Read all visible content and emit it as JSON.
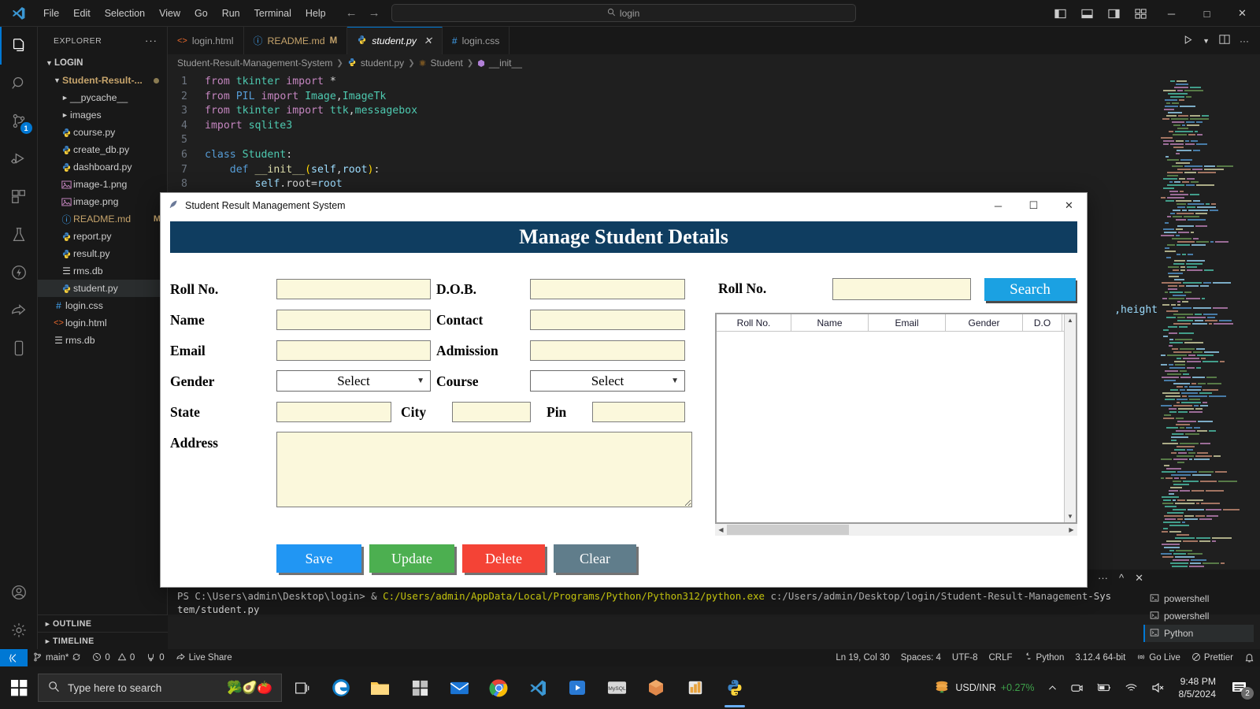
{
  "vscode": {
    "menus": [
      "File",
      "Edit",
      "Selection",
      "View",
      "Go",
      "Run",
      "Terminal",
      "Help"
    ],
    "command_center": {
      "text": "login",
      "icon": "search-icon"
    },
    "window_controls": {
      "minimize": "─",
      "maximize": "□",
      "close": "✕"
    },
    "activity_bar": {
      "source_control_badge": "1"
    },
    "sidebar": {
      "title": "EXPLORER",
      "more_actions": "···",
      "root": "LOGIN",
      "items": [
        {
          "label": "Student-Result-...",
          "type": "folder",
          "expanded": true,
          "indent": 1,
          "dirty": true
        },
        {
          "label": "__pycache__",
          "type": "folder",
          "expanded": false,
          "indent": 2
        },
        {
          "label": "images",
          "type": "folder",
          "expanded": false,
          "indent": 2
        },
        {
          "label": "course.py",
          "type": "python",
          "indent": 2
        },
        {
          "label": "create_db.py",
          "type": "python",
          "indent": 2
        },
        {
          "label": "dashboard.py",
          "type": "python",
          "indent": 2
        },
        {
          "label": "image-1.png",
          "type": "image",
          "indent": 2
        },
        {
          "label": "image.png",
          "type": "image",
          "indent": 2
        },
        {
          "label": "README.md",
          "type": "markdown",
          "indent": 2,
          "badge": "M",
          "modified": true
        },
        {
          "label": "report.py",
          "type": "python",
          "indent": 2
        },
        {
          "label": "result.py",
          "type": "python",
          "indent": 2
        },
        {
          "label": "rms.db",
          "type": "database",
          "indent": 2
        },
        {
          "label": "student.py",
          "type": "python",
          "indent": 2,
          "selected": true
        },
        {
          "label": "login.css",
          "type": "css",
          "indent": 1
        },
        {
          "label": "login.html",
          "type": "html",
          "indent": 1
        },
        {
          "label": "rms.db",
          "type": "database",
          "indent": 1
        }
      ],
      "sections": [
        "OUTLINE",
        "TIMELINE"
      ]
    },
    "tabs": [
      {
        "label": "login.html",
        "icon": "html-icon",
        "active": false
      },
      {
        "label": "README.md",
        "icon": "markdown-icon",
        "active": false,
        "badge": "M"
      },
      {
        "label": "student.py",
        "icon": "python-icon",
        "active": true,
        "closeable": true
      },
      {
        "label": "login.css",
        "icon": "css-icon",
        "active": false
      }
    ],
    "breadcrumb": [
      "Student-Result-Management-System",
      "student.py",
      "Student",
      "__init__"
    ],
    "code_lines": [
      {
        "n": "1",
        "tokens": [
          [
            "k-kw",
            "from"
          ],
          [
            "k-txt",
            " "
          ],
          [
            "k-mod",
            "tkinter"
          ],
          [
            "k-txt",
            " "
          ],
          [
            "k-kw",
            "import"
          ],
          [
            "k-txt",
            " "
          ],
          [
            "k-star",
            "*"
          ]
        ]
      },
      {
        "n": "2",
        "tokens": [
          [
            "k-kw",
            "from"
          ],
          [
            "k-txt",
            " "
          ],
          [
            "k-cls",
            "PIL"
          ],
          [
            "k-txt",
            " "
          ],
          [
            "k-kw",
            "import"
          ],
          [
            "k-txt",
            " "
          ],
          [
            "k-mod",
            "Image"
          ],
          [
            "k-txt",
            ","
          ],
          [
            "k-mod",
            "ImageTk"
          ]
        ]
      },
      {
        "n": "3",
        "tokens": [
          [
            "k-kw",
            "from"
          ],
          [
            "k-txt",
            " "
          ],
          [
            "k-mod",
            "tkinter"
          ],
          [
            "k-txt",
            " "
          ],
          [
            "k-kw",
            "import"
          ],
          [
            "k-txt",
            " "
          ],
          [
            "k-mod",
            "ttk"
          ],
          [
            "k-txt",
            ","
          ],
          [
            "k-mod",
            "messagebox"
          ]
        ]
      },
      {
        "n": "4",
        "tokens": [
          [
            "k-kw",
            "import"
          ],
          [
            "k-txt",
            " "
          ],
          [
            "k-mod",
            "sqlite3"
          ]
        ]
      },
      {
        "n": "5",
        "tokens": []
      },
      {
        "n": "6",
        "tokens": [
          [
            "k-cls",
            "class"
          ],
          [
            "k-txt",
            " "
          ],
          [
            "k-name",
            "Student"
          ],
          [
            "k-txt",
            ":"
          ]
        ]
      },
      {
        "n": "7",
        "tokens": [
          [
            "k-txt",
            "    "
          ],
          [
            "k-cls",
            "def"
          ],
          [
            "k-txt",
            " "
          ],
          [
            "k-fn",
            "__init__"
          ],
          [
            "k-pl",
            "("
          ],
          [
            "k-par",
            "self"
          ],
          [
            "k-txt",
            ","
          ],
          [
            "k-par",
            "root"
          ],
          [
            "k-pl",
            ")"
          ],
          [
            "k-txt",
            ":"
          ]
        ]
      },
      {
        "n": "8",
        "tokens": [
          [
            "k-txt",
            "        "
          ],
          [
            "k-par",
            "self"
          ],
          [
            "k-txt",
            ".root="
          ],
          [
            "k-par",
            "root"
          ]
        ]
      }
    ],
    "code_right_snippet": ",height",
    "panel": {
      "terminal_text_line1_prompt": "PS C:\\Users\\admin\\Desktop\\login>",
      "terminal_text_line1_cmd": " & ",
      "terminal_text_line1_path": "C:/Users/admin/AppData/Local/Programs/Python/Python312/python.exe",
      "terminal_text_line1_arg": " c:/Users/admin/Desktop/login/Student-Result-Management-Sys",
      "terminal_text_line2": "tem/student.py",
      "actions": [
        "+",
        "⌄",
        "···",
        "∧",
        "✕"
      ],
      "terminals": [
        {
          "label": "powershell",
          "active": false
        },
        {
          "label": "powershell",
          "active": false
        },
        {
          "label": "Python",
          "active": true
        }
      ]
    },
    "statusbar": {
      "remote_icon": "remote-window-icon",
      "branch": "main*",
      "sync_icon": "sync-icon",
      "errors": "0",
      "warnings": "0",
      "ports": "0",
      "live_share": "Live Share",
      "cursor": "Ln 19, Col 30",
      "spaces": "Spaces: 4",
      "encoding": "UTF-8",
      "eol": "CRLF",
      "language": "Python",
      "interpreter": "3.12.4 64-bit",
      "go_live": "Go Live",
      "prettier": "Prettier",
      "bell": "notifications-icon"
    }
  },
  "taskbar": {
    "search_placeholder": "Type here to search",
    "emoji": "🥦🥑🍅",
    "apps": [
      "task-view-icon",
      "edge-icon",
      "file-explorer-icon",
      "store-icon",
      "mail-icon",
      "chrome-icon",
      "vscode-icon",
      "media-player-icon",
      "mysql-icon",
      "package-icon",
      "excel-icon",
      "python-app-icon"
    ],
    "tray": {
      "stock_label": "USD/INR",
      "stock_change": "+0.27%",
      "time": "9:48 PM",
      "date": "8/5/2024",
      "notification_count": "2"
    }
  },
  "dialog": {
    "window_title": "Student Result Management System",
    "header": "Manage Student Details",
    "controls": {
      "minimize": "─",
      "maximize": "☐",
      "close": "✕"
    },
    "fields": {
      "roll_no": {
        "label": "Roll No.",
        "value": ""
      },
      "dob": {
        "label": "D.O.B.",
        "value": ""
      },
      "name": {
        "label": "Name",
        "value": ""
      },
      "contact": {
        "label": "Contact",
        "value": ""
      },
      "email": {
        "label": "Email",
        "value": ""
      },
      "admission": {
        "label": "Admission",
        "value": ""
      },
      "gender": {
        "label": "Gender",
        "value": "Select"
      },
      "course": {
        "label": "Course",
        "value": "Select"
      },
      "state": {
        "label": "State",
        "value": ""
      },
      "city": {
        "label": "City",
        "value": ""
      },
      "pin": {
        "label": "Pin",
        "value": ""
      },
      "address": {
        "label": "Address",
        "value": ""
      }
    },
    "buttons": {
      "save": {
        "label": "Save",
        "color": "#2196f3"
      },
      "update": {
        "label": "Update",
        "color": "#4caf50"
      },
      "delete": {
        "label": "Delete",
        "color": "#f44336"
      },
      "clear": {
        "label": "Clear",
        "color": "#607d8b"
      }
    },
    "search": {
      "label": "Roll No.",
      "value": "",
      "button_label": "Search",
      "button_color": "#1ba1e2"
    },
    "table": {
      "columns": [
        "Roll No.",
        "Name",
        "Email",
        "Gender",
        "D.O"
      ],
      "rows": []
    }
  }
}
